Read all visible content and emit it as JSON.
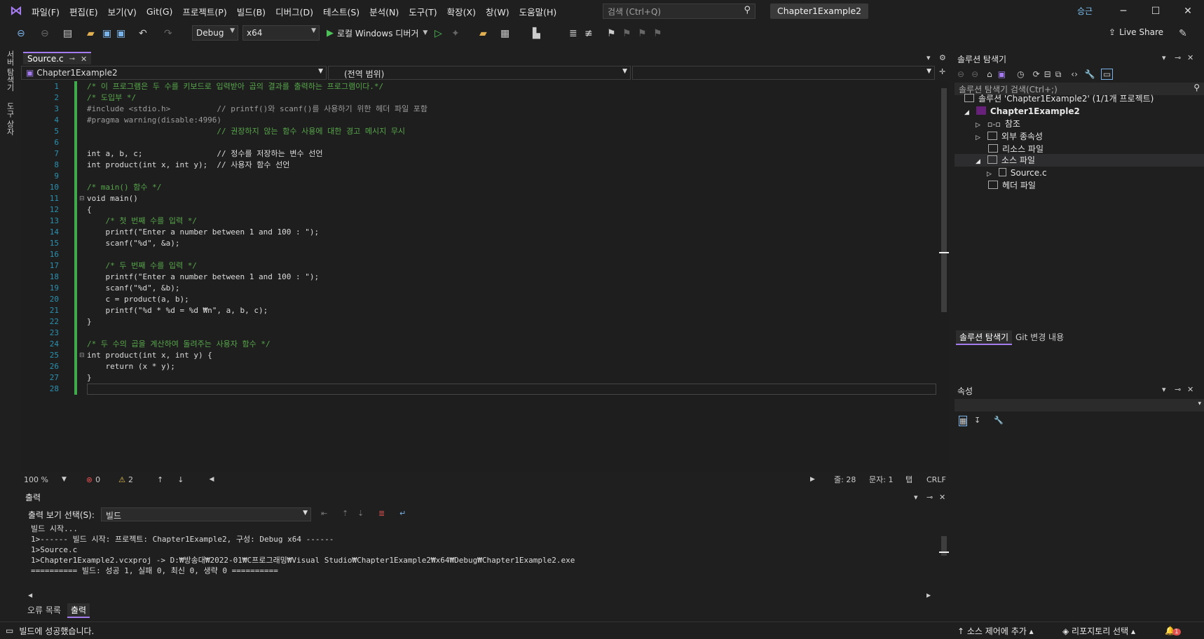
{
  "menu": [
    "파일(F)",
    "편집(E)",
    "보기(V)",
    "Git(G)",
    "프로젝트(P)",
    "빌드(B)",
    "디버그(D)",
    "테스트(S)",
    "분석(N)",
    "도구(T)",
    "확장(X)",
    "창(W)",
    "도움말(H)"
  ],
  "search": {
    "placeholder": "검색 (Ctrl+Q)"
  },
  "solution_title": "Chapter1Example2",
  "avatar": "승근",
  "toolbar": {
    "config": "Debug",
    "platform": "x64",
    "run_label": "로컬 Windows 디버거",
    "live_share": "Live Share"
  },
  "left_tabs": [
    "서버 탐색기",
    "도구 상자"
  ],
  "editor": {
    "tab": "Source.c",
    "nav_project": "Chapter1Example2",
    "nav_scope": "(전역 범위)",
    "line_numbers": [
      "1",
      "2",
      "3",
      "4",
      "5",
      "6",
      "7",
      "8",
      "9",
      "10",
      "11",
      "12",
      "13",
      "14",
      "15",
      "16",
      "17",
      "18",
      "19",
      "20",
      "21",
      "22",
      "23",
      "24",
      "25",
      "26",
      "27",
      "28"
    ],
    "lines": [
      "/* 이 프로그램은 두 수를 키보드로 입력받아 곱의 결과를 출력하는 프로그램이다.*/",
      "/* 도입부 */",
      "#include <stdio.h>          // printf()와 scanf()를 사용하기 위한 헤더 파일 포함",
      "#pragma warning(disable:4996)",
      "                            // 권장하지 않는 함수 사용에 대한 경고 메시지 무시",
      "",
      "int a, b, c;                // 정수를 저장하는 변수 선언",
      "int product(int x, int y);  // 사용자 함수 선언",
      "",
      "/* main() 함수 */",
      "void main()",
      "{",
      "    /* 첫 번째 수를 입력 */",
      "    printf(\"Enter a number between 1 and 100 : \");",
      "    scanf(\"%d\", &a);",
      "",
      "    /* 두 번째 수를 입력 */",
      "    printf(\"Enter a number between 1 and 100 : \");",
      "    scanf(\"%d\", &b);",
      "    c = product(a, b);",
      "    printf(\"%d * %d = %d ₩n\", a, b, c);",
      "}",
      "",
      "/* 두 수의 곱을 계산하여 돌려주는 사용자 함수 */",
      "int product(int x, int y) {",
      "    return (x * y);",
      "}",
      ""
    ]
  },
  "editor_status": {
    "zoom": "100 %",
    "errors": "0",
    "warnings": "2",
    "line": "줄: 28",
    "col": "문자: 1",
    "tab": "탭",
    "eol": "CRLF"
  },
  "output": {
    "title": "출력",
    "select_label": "출력 보기 선택(S):",
    "select_value": "빌드",
    "lines": [
      "빌드 시작...",
      "1>------ 빌드 시작: 프로젝트: Chapter1Example2, 구성: Debug x64 ------",
      "1>Source.c",
      "1>Chapter1Example2.vcxproj -> D:₩방송대₩2022-01₩C프로그래밍₩Visual Studio₩Chapter1Example2₩x64₩Debug₩Chapter1Example2.exe",
      "========== 빌드: 성공 1, 실패 0, 최신 0, 생략 0 =========="
    ],
    "tabs": [
      "오류 목록",
      "출력"
    ]
  },
  "solution_explorer": {
    "title": "솔루션 탐색기",
    "search_placeholder": "솔루션 탐색기 검색(Ctrl+;)",
    "solution": "솔루션 'Chapter1Example2' (1/1개 프로젝트)",
    "project": "Chapter1Example2",
    "items": [
      "참조",
      "외부 종속성",
      "리소스 파일",
      "소스 파일",
      "Source.c",
      "헤더 파일"
    ],
    "tabs": [
      "솔루션 탐색기",
      "Git 변경 내용"
    ]
  },
  "properties": {
    "title": "속성"
  },
  "status": {
    "message": "빌드에 성공했습니다.",
    "source_control": "소스 제어에 추가",
    "repo": "리포지토리 선택",
    "notifications": "1"
  }
}
